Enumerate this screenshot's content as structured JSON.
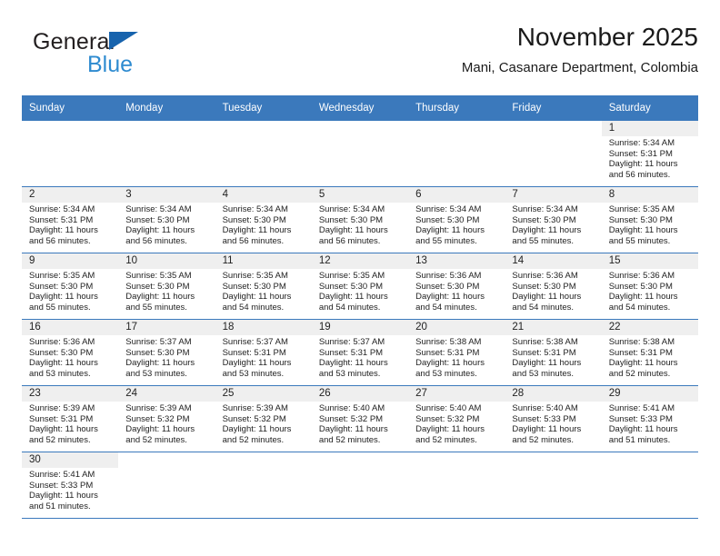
{
  "brand": {
    "name_top": "General",
    "name_bottom": "Blue",
    "flag_color": "#1763ad",
    "blue_color": "#2e8bd0"
  },
  "header": {
    "title": "November 2025",
    "subtitle": "Mani, Casanare Department, Colombia"
  },
  "theme": {
    "header_bg": "#3b79bc",
    "header_text": "#ffffff",
    "daynum_band_bg": "#efefef",
    "grid_line": "#3b79bc",
    "cell_bg": "#ffffff",
    "text": "#222222"
  },
  "calendar": {
    "weekday_headers": [
      "Sunday",
      "Monday",
      "Tuesday",
      "Wednesday",
      "Thursday",
      "Friday",
      "Saturday"
    ],
    "labels": {
      "sunrise": "Sunrise:",
      "sunset": "Sunset:",
      "daylight": "Daylight:"
    },
    "weeks": [
      [
        {
          "blank": true
        },
        {
          "blank": true
        },
        {
          "blank": true
        },
        {
          "blank": true
        },
        {
          "blank": true
        },
        {
          "blank": true
        },
        {
          "day": "1",
          "sunrise": "Sunrise: 5:34 AM",
          "sunset": "Sunset: 5:31 PM",
          "daylight": "Daylight: 11 hours and 56 minutes."
        }
      ],
      [
        {
          "day": "2",
          "sunrise": "Sunrise: 5:34 AM",
          "sunset": "Sunset: 5:31 PM",
          "daylight": "Daylight: 11 hours and 56 minutes."
        },
        {
          "day": "3",
          "sunrise": "Sunrise: 5:34 AM",
          "sunset": "Sunset: 5:30 PM",
          "daylight": "Daylight: 11 hours and 56 minutes."
        },
        {
          "day": "4",
          "sunrise": "Sunrise: 5:34 AM",
          "sunset": "Sunset: 5:30 PM",
          "daylight": "Daylight: 11 hours and 56 minutes."
        },
        {
          "day": "5",
          "sunrise": "Sunrise: 5:34 AM",
          "sunset": "Sunset: 5:30 PM",
          "daylight": "Daylight: 11 hours and 56 minutes."
        },
        {
          "day": "6",
          "sunrise": "Sunrise: 5:34 AM",
          "sunset": "Sunset: 5:30 PM",
          "daylight": "Daylight: 11 hours and 55 minutes."
        },
        {
          "day": "7",
          "sunrise": "Sunrise: 5:34 AM",
          "sunset": "Sunset: 5:30 PM",
          "daylight": "Daylight: 11 hours and 55 minutes."
        },
        {
          "day": "8",
          "sunrise": "Sunrise: 5:35 AM",
          "sunset": "Sunset: 5:30 PM",
          "daylight": "Daylight: 11 hours and 55 minutes."
        }
      ],
      [
        {
          "day": "9",
          "sunrise": "Sunrise: 5:35 AM",
          "sunset": "Sunset: 5:30 PM",
          "daylight": "Daylight: 11 hours and 55 minutes."
        },
        {
          "day": "10",
          "sunrise": "Sunrise: 5:35 AM",
          "sunset": "Sunset: 5:30 PM",
          "daylight": "Daylight: 11 hours and 55 minutes."
        },
        {
          "day": "11",
          "sunrise": "Sunrise: 5:35 AM",
          "sunset": "Sunset: 5:30 PM",
          "daylight": "Daylight: 11 hours and 54 minutes."
        },
        {
          "day": "12",
          "sunrise": "Sunrise: 5:35 AM",
          "sunset": "Sunset: 5:30 PM",
          "daylight": "Daylight: 11 hours and 54 minutes."
        },
        {
          "day": "13",
          "sunrise": "Sunrise: 5:36 AM",
          "sunset": "Sunset: 5:30 PM",
          "daylight": "Daylight: 11 hours and 54 minutes."
        },
        {
          "day": "14",
          "sunrise": "Sunrise: 5:36 AM",
          "sunset": "Sunset: 5:30 PM",
          "daylight": "Daylight: 11 hours and 54 minutes."
        },
        {
          "day": "15",
          "sunrise": "Sunrise: 5:36 AM",
          "sunset": "Sunset: 5:30 PM",
          "daylight": "Daylight: 11 hours and 54 minutes."
        }
      ],
      [
        {
          "day": "16",
          "sunrise": "Sunrise: 5:36 AM",
          "sunset": "Sunset: 5:30 PM",
          "daylight": "Daylight: 11 hours and 53 minutes."
        },
        {
          "day": "17",
          "sunrise": "Sunrise: 5:37 AM",
          "sunset": "Sunset: 5:30 PM",
          "daylight": "Daylight: 11 hours and 53 minutes."
        },
        {
          "day": "18",
          "sunrise": "Sunrise: 5:37 AM",
          "sunset": "Sunset: 5:31 PM",
          "daylight": "Daylight: 11 hours and 53 minutes."
        },
        {
          "day": "19",
          "sunrise": "Sunrise: 5:37 AM",
          "sunset": "Sunset: 5:31 PM",
          "daylight": "Daylight: 11 hours and 53 minutes."
        },
        {
          "day": "20",
          "sunrise": "Sunrise: 5:38 AM",
          "sunset": "Sunset: 5:31 PM",
          "daylight": "Daylight: 11 hours and 53 minutes."
        },
        {
          "day": "21",
          "sunrise": "Sunrise: 5:38 AM",
          "sunset": "Sunset: 5:31 PM",
          "daylight": "Daylight: 11 hours and 53 minutes."
        },
        {
          "day": "22",
          "sunrise": "Sunrise: 5:38 AM",
          "sunset": "Sunset: 5:31 PM",
          "daylight": "Daylight: 11 hours and 52 minutes."
        }
      ],
      [
        {
          "day": "23",
          "sunrise": "Sunrise: 5:39 AM",
          "sunset": "Sunset: 5:31 PM",
          "daylight": "Daylight: 11 hours and 52 minutes."
        },
        {
          "day": "24",
          "sunrise": "Sunrise: 5:39 AM",
          "sunset": "Sunset: 5:32 PM",
          "daylight": "Daylight: 11 hours and 52 minutes."
        },
        {
          "day": "25",
          "sunrise": "Sunrise: 5:39 AM",
          "sunset": "Sunset: 5:32 PM",
          "daylight": "Daylight: 11 hours and 52 minutes."
        },
        {
          "day": "26",
          "sunrise": "Sunrise: 5:40 AM",
          "sunset": "Sunset: 5:32 PM",
          "daylight": "Daylight: 11 hours and 52 minutes."
        },
        {
          "day": "27",
          "sunrise": "Sunrise: 5:40 AM",
          "sunset": "Sunset: 5:32 PM",
          "daylight": "Daylight: 11 hours and 52 minutes."
        },
        {
          "day": "28",
          "sunrise": "Sunrise: 5:40 AM",
          "sunset": "Sunset: 5:33 PM",
          "daylight": "Daylight: 11 hours and 52 minutes."
        },
        {
          "day": "29",
          "sunrise": "Sunrise: 5:41 AM",
          "sunset": "Sunset: 5:33 PM",
          "daylight": "Daylight: 11 hours and 51 minutes."
        }
      ],
      [
        {
          "day": "30",
          "sunrise": "Sunrise: 5:41 AM",
          "sunset": "Sunset: 5:33 PM",
          "daylight": "Daylight: 11 hours and 51 minutes."
        },
        {
          "blank": true
        },
        {
          "blank": true
        },
        {
          "blank": true
        },
        {
          "blank": true
        },
        {
          "blank": true
        },
        {
          "blank": true
        }
      ]
    ]
  }
}
